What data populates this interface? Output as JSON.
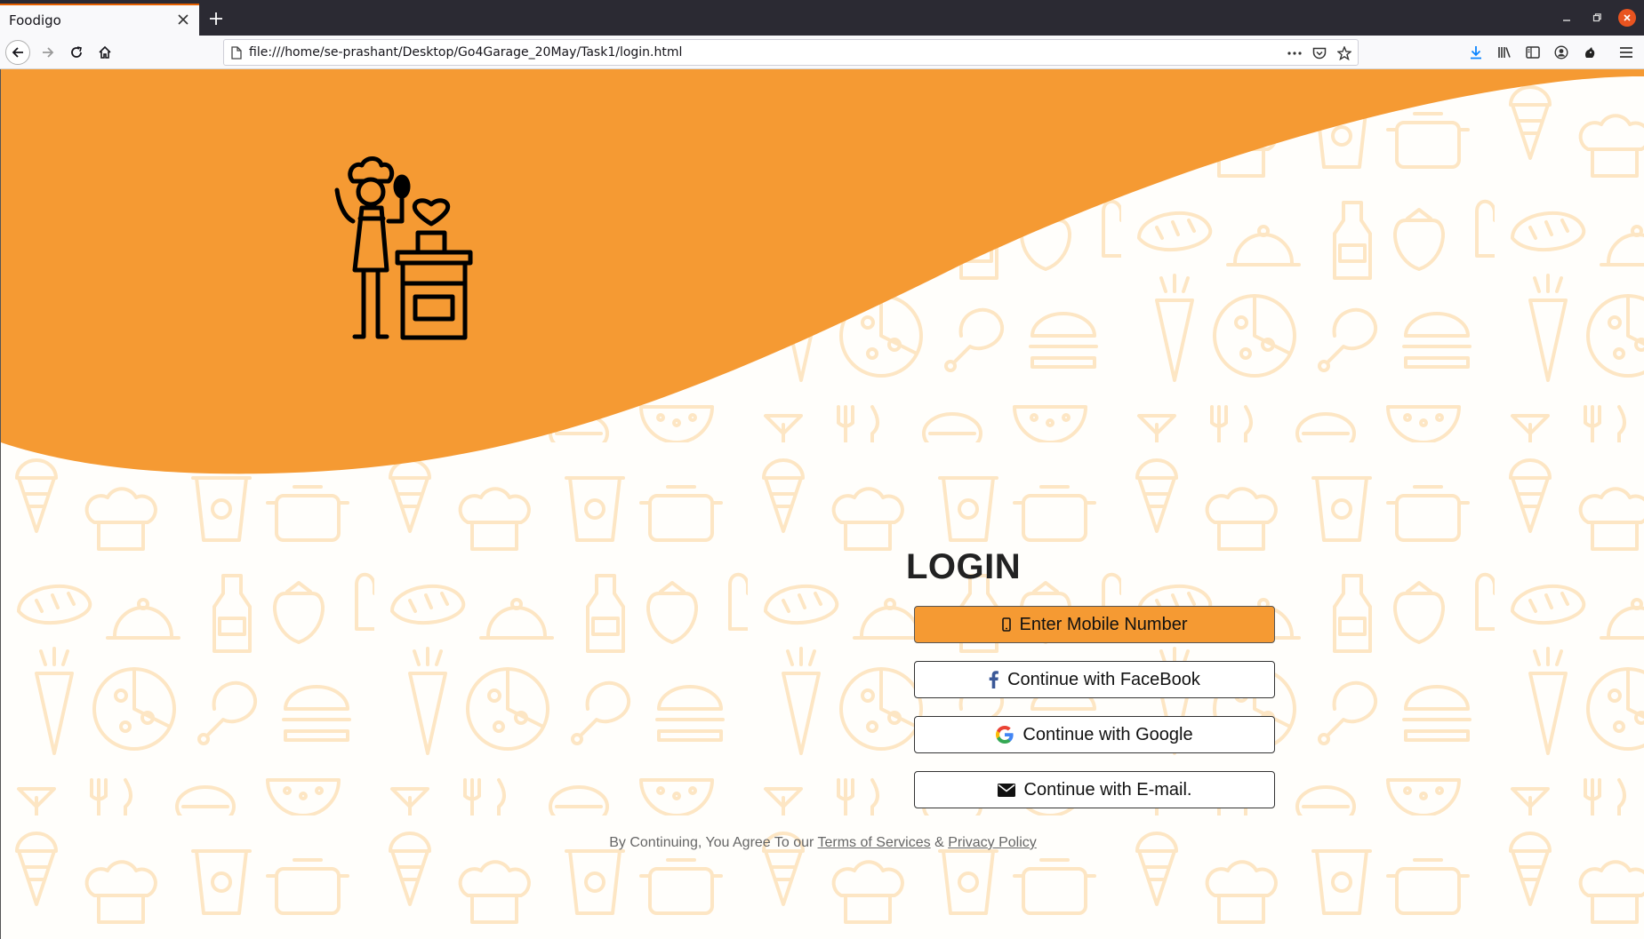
{
  "browser": {
    "tab_title": "Foodigo",
    "url": "file:///home/se-prashant/Desktop/Go4Garage_20May/Task1/login.html",
    "icons": [
      "back-arrow-icon",
      "forward-arrow-icon",
      "reload-icon",
      "home-icon",
      "page-icon",
      "more-icon",
      "pocket-icon",
      "bookmark-star-icon",
      "download-icon",
      "library-icon",
      "sidebar-icon",
      "account-icon",
      "extension-icon",
      "menu-icon"
    ]
  },
  "page": {
    "login_title": "LOGIN",
    "buttons": {
      "mobile": "Enter Mobile Number",
      "facebook": "Continue with FaceBook",
      "google": "Continue with Google",
      "email": "Continue with E-mail."
    },
    "footer": {
      "prefix": "By Continuing, You Agree To our",
      "terms": "Terms of Services",
      "amp": "&",
      "privacy": "Privacy Policy"
    },
    "colors": {
      "brand_orange": "#f59a33",
      "doodle": "#fde6c4",
      "background": "#fffefb"
    }
  }
}
